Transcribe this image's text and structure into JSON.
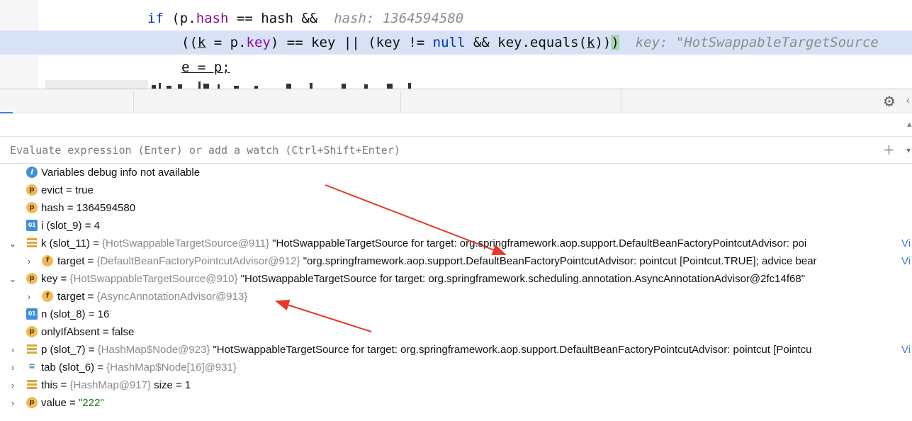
{
  "editor": {
    "line1": {
      "kw_if": "if",
      "open": " (",
      "p": "p",
      "dot": ".",
      "field": "hash",
      "rest": " == hash &&",
      "hint": "hash: 1364594580"
    },
    "line2": {
      "open": "((",
      "k": "k",
      "mid1": " = p.",
      "field": "key",
      "mid2": ") == key || (key != ",
      "null_kw": "null",
      "mid3": " && key.equals(",
      "k2": "k",
      "close": "))",
      "last_paren": ")",
      "hint": "key: \"HotSwappableTargetSource"
    },
    "line3": {
      "text": "e = p;"
    }
  },
  "evaluate": {
    "placeholder": "Evaluate expression (Enter) or add a watch (Ctrl+Shift+Enter)"
  },
  "variables": [
    {
      "icon": "info",
      "name": "Variables debug info not available"
    },
    {
      "icon": "p",
      "name": "evict",
      "op": " = ",
      "value": "true"
    },
    {
      "icon": "p",
      "name": "hash",
      "op": " = ",
      "value": "1364594580"
    },
    {
      "icon": "01",
      "name": "i (slot_9)",
      "op": " = ",
      "value": "4"
    },
    {
      "icon": "lines",
      "expanded": true,
      "name": "k (slot_11)",
      "op": " = ",
      "ref": "{HotSwappableTargetSource@911}",
      "value": "\"HotSwappableTargetSource for target: org.springframework.aop.support.DefaultBeanFactoryPointcutAdvisor: poi",
      "more": "Vi"
    },
    {
      "icon": "f",
      "expanded": false,
      "name": "target",
      "op": " = ",
      "ref": "{DefaultBeanFactoryPointcutAdvisor@912}",
      "value": "\"org.springframework.aop.support.DefaultBeanFactoryPointcutAdvisor: pointcut [Pointcut.TRUE]; advice bear",
      "more": "Vi"
    },
    {
      "icon": "p",
      "expanded": true,
      "name": "key",
      "op": " = ",
      "ref": "{HotSwappableTargetSource@910}",
      "value": "\"HotSwappableTargetSource for target: org.springframework.scheduling.annotation.AsyncAnnotationAdvisor@2fc14f68\""
    },
    {
      "icon": "f",
      "expanded": false,
      "name": "target",
      "op": " = ",
      "ref": "{AsyncAnnotationAdvisor@913}"
    },
    {
      "icon": "01",
      "name": "n (slot_8)",
      "op": " = ",
      "value": "16"
    },
    {
      "icon": "p",
      "name": "onlyIfAbsent",
      "op": " = ",
      "value": "false"
    },
    {
      "icon": "lines",
      "expanded": false,
      "name": "p (slot_7)",
      "op": " = ",
      "ref": "{HashMap$Node@923}",
      "value": "\"HotSwappableTargetSource for target: org.springframework.aop.support.DefaultBeanFactoryPointcutAdvisor: pointcut [Pointcu",
      "more": "Vi"
    },
    {
      "icon": "arr",
      "expanded": false,
      "name": "tab (slot_6)",
      "op": " = ",
      "ref": "{HashMap$Node[16]@931}"
    },
    {
      "icon": "lines",
      "expanded": false,
      "name": "this",
      "op": " = ",
      "ref": "{HashMap@917}",
      "value": " size = 1"
    },
    {
      "icon": "p",
      "expanded": false,
      "name": "value",
      "op": " = ",
      "value_string": "\"222\""
    }
  ],
  "icons": {
    "settings": "gear-icon",
    "add_watch": "plus-icon",
    "annotation_color": "#e8372b"
  }
}
